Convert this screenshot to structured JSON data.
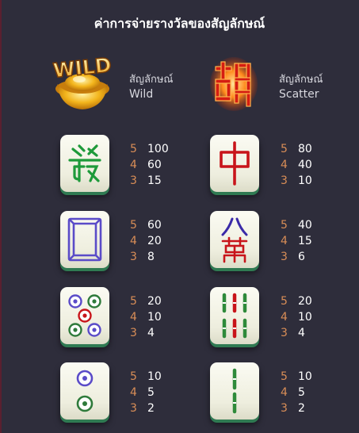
{
  "title": "ค่าการจ่ายรางวัลของสัญลักษณ์",
  "specials": [
    {
      "icon": "wild-gold-ingot-icon",
      "label": "สัญลักษณ์",
      "name": "Wild"
    },
    {
      "icon": "scatter-hu-character-icon",
      "label": "สัญลักษณ์",
      "name": "Scatter"
    }
  ],
  "symbols": [
    {
      "icon": "green-fa-tile-icon",
      "pays": [
        {
          "count": "5",
          "value": "100"
        },
        {
          "count": "4",
          "value": "60"
        },
        {
          "count": "3",
          "value": "15"
        }
      ]
    },
    {
      "icon": "red-zhong-tile-icon",
      "pays": [
        {
          "count": "5",
          "value": "80"
        },
        {
          "count": "4",
          "value": "40"
        },
        {
          "count": "3",
          "value": "10"
        }
      ]
    },
    {
      "icon": "white-dragon-tile-icon",
      "pays": [
        {
          "count": "5",
          "value": "60"
        },
        {
          "count": "4",
          "value": "20"
        },
        {
          "count": "3",
          "value": "8"
        }
      ]
    },
    {
      "icon": "eight-wan-tile-icon",
      "pays": [
        {
          "count": "5",
          "value": "40"
        },
        {
          "count": "4",
          "value": "15"
        },
        {
          "count": "3",
          "value": "6"
        }
      ]
    },
    {
      "icon": "five-dots-tile-icon",
      "pays": [
        {
          "count": "5",
          "value": "20"
        },
        {
          "count": "4",
          "value": "10"
        },
        {
          "count": "3",
          "value": "4"
        }
      ]
    },
    {
      "icon": "six-bamboo-tile-icon",
      "pays": [
        {
          "count": "5",
          "value": "20"
        },
        {
          "count": "4",
          "value": "10"
        },
        {
          "count": "3",
          "value": "4"
        }
      ]
    },
    {
      "icon": "two-dots-tile-icon",
      "pays": [
        {
          "count": "5",
          "value": "10"
        },
        {
          "count": "4",
          "value": "5"
        },
        {
          "count": "3",
          "value": "2"
        }
      ]
    },
    {
      "icon": "two-bamboo-tile-icon",
      "pays": [
        {
          "count": "5",
          "value": "10"
        },
        {
          "count": "4",
          "value": "5"
        },
        {
          "count": "3",
          "value": "2"
        }
      ]
    }
  ],
  "colors": {
    "background": "#2e2d3b",
    "count": "#d98e57",
    "value": "#ffffff",
    "tile_base": "#2f7a52"
  }
}
